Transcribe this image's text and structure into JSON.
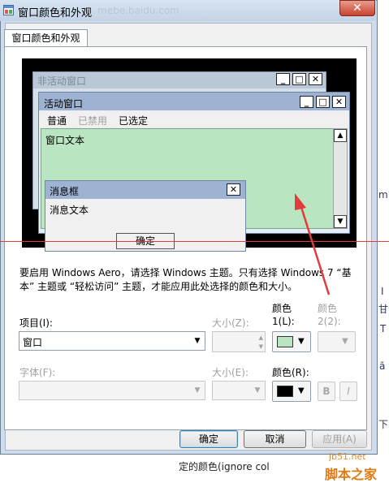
{
  "window": {
    "title": "窗口颜色和外观",
    "close_symbol": "✕",
    "behind_url": "mebe.baidu.com"
  },
  "tabs": [
    {
      "label": "窗口颜色和外观"
    }
  ],
  "preview": {
    "inactive_title": "非活动窗口",
    "active_title": "活动窗口",
    "menu": {
      "normal": "普通",
      "disabled": "已禁用",
      "selected": "已选定"
    },
    "window_text": "窗口文本",
    "message_title": "消息框",
    "message_text": "消息文本",
    "ok_label": "确定",
    "min_symbol": "_",
    "max_symbol": "□",
    "close_symbol": "✕",
    "scroll_up": "▲",
    "scroll_down": "▼"
  },
  "notice": "要启用 Windows Aero，请选择 Windows 主题。只有选择 Windows 7 “基本” 主题或 “轻松访问” 主题，才能应用此处选择的颜色和大小。",
  "form": {
    "item_label": "项目(I):",
    "item_value": "窗口",
    "size_label": "大小(Z):",
    "color1_label_a": "颜色",
    "color1_label_b": "1(L):",
    "color1_value": "#b9e6c0",
    "color2_label_a": "颜色",
    "color2_label_b": "2(2):",
    "font_label": "字体(F):",
    "size2_label": "大小(E):",
    "font_color_label": "颜色(R):",
    "font_color_value": "#000000",
    "bold_label": "B",
    "italic_label": "I"
  },
  "buttons": {
    "ok": "确定",
    "cancel": "取消",
    "apply": "应用(A)"
  },
  "background": {
    "text": "定的颜色(ignore col",
    "side_marks": [
      "m",
      "I",
      "甘",
      "T",
      "ã",
      "下"
    ]
  },
  "watermark": {
    "url": "jb51.net",
    "name": "脚本之家"
  },
  "colors": {
    "title_active": "#9db3d1",
    "window_bg": "#b9e6c0",
    "annotation": "#e23b3b"
  }
}
